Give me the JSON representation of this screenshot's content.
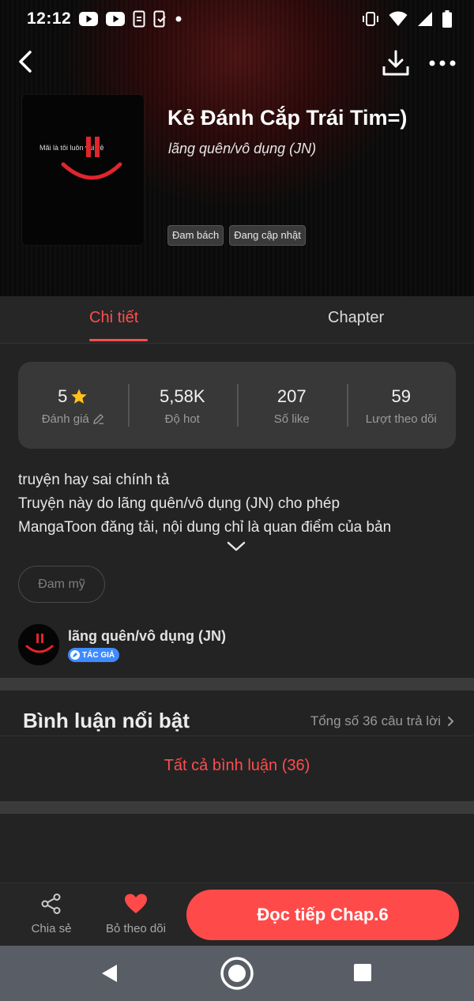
{
  "status_bar": {
    "time": "12:12"
  },
  "book": {
    "title": "Kẻ Đánh Cắp Trái Tim=)",
    "author": "lãng quên/vô dụng (JN)",
    "cover_text": "Mãi là tôi luôn vui vẻ",
    "tags": [
      "Đam bách",
      "Đang cập nhật"
    ]
  },
  "tabs": {
    "detail": "Chi tiết",
    "chapter": "Chapter"
  },
  "stats": [
    {
      "value": "5",
      "label": "Đánh giá"
    },
    {
      "value": "5,58K",
      "label": "Độ hot"
    },
    {
      "value": "207",
      "label": "Số like"
    },
    {
      "value": "59",
      "label": "Lượt theo dõi"
    }
  ],
  "description": {
    "lines": [
      "truyện hay sai chính tả",
      "Truyện này do lãng quên/vô dụng (JN) cho phép",
      "MangaToon đăng tải, nội dung chỉ là quan điểm của bản"
    ]
  },
  "genre_chip": "Đam mỹ",
  "author_row": {
    "name": "lãng quên/vô dụng (JN)",
    "badge": "TÁC GIẢ"
  },
  "comments": {
    "title": "Bình luận nổi bật",
    "total": "Tổng số 36 câu trả lời",
    "all": "Tất cả bình luận (36)"
  },
  "bottom_bar": {
    "share": "Chia sẻ",
    "unfollow": "Bỏ theo dõi",
    "read": "Đọc tiếp Chap.6"
  },
  "colors": {
    "accent": "#ff4d4f",
    "background": "#232323",
    "card": "#383838",
    "badge": "#3d8bff"
  }
}
